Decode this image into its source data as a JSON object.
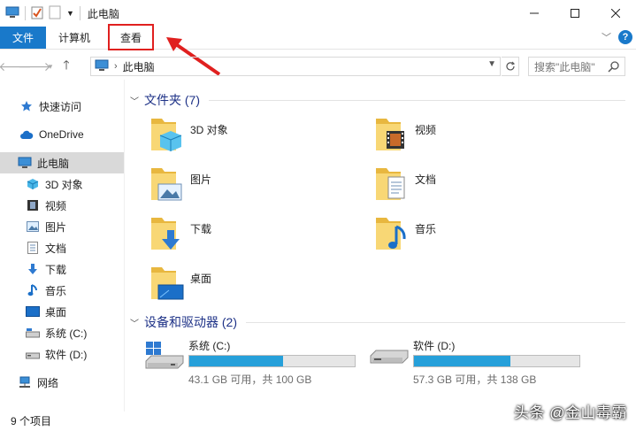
{
  "window": {
    "title": "此电脑"
  },
  "ribbon": {
    "file_tab": "文件",
    "computer_tab": "计算机",
    "view_tab": "查看"
  },
  "address": {
    "location": "此电脑",
    "search_placeholder": "搜索\"此电脑\""
  },
  "sidebar": {
    "items": [
      {
        "label": "快速访问",
        "icon": "star-icon"
      },
      {
        "label": "OneDrive",
        "icon": "cloud-icon"
      },
      {
        "label": "此电脑",
        "icon": "computer-icon"
      },
      {
        "label": "3D 对象",
        "icon": "cube-icon"
      },
      {
        "label": "视频",
        "icon": "film-icon"
      },
      {
        "label": "图片",
        "icon": "picture-icon"
      },
      {
        "label": "文档",
        "icon": "document-icon"
      },
      {
        "label": "下载",
        "icon": "download-arrow-icon"
      },
      {
        "label": "音乐",
        "icon": "music-note-icon"
      },
      {
        "label": "桌面",
        "icon": "desktop-icon"
      },
      {
        "label": "系统 (C:)",
        "icon": "drive-icon"
      },
      {
        "label": "软件 (D:)",
        "icon": "drive-icon"
      },
      {
        "label": "网络",
        "icon": "network-icon"
      }
    ]
  },
  "main": {
    "folders_header": "文件夹 (7)",
    "folders": [
      {
        "label": "3D 对象",
        "icon": "cube-icon"
      },
      {
        "label": "视频",
        "icon": "film-icon"
      },
      {
        "label": "图片",
        "icon": "picture-icon"
      },
      {
        "label": "文档",
        "icon": "document-icon"
      },
      {
        "label": "下载",
        "icon": "download-arrow-icon"
      },
      {
        "label": "音乐",
        "icon": "music-note-icon"
      },
      {
        "label": "桌面",
        "icon": "desktop-icon"
      }
    ],
    "drives_header": "设备和驱动器 (2)",
    "drives": [
      {
        "label": "系统 (C:)",
        "free": "43.1 GB 可用，共 100 GB",
        "used_fraction": 0.569
      },
      {
        "label": "软件 (D:)",
        "free": "57.3 GB 可用，共 138 GB",
        "used_fraction": 0.585
      }
    ]
  },
  "status": {
    "item_count": "9 个项目"
  },
  "watermark": "头条 @金山毒霸",
  "colors": {
    "accent": "#1979ca",
    "drive_bar": "#26a0da",
    "annotation": "#e0201f"
  }
}
